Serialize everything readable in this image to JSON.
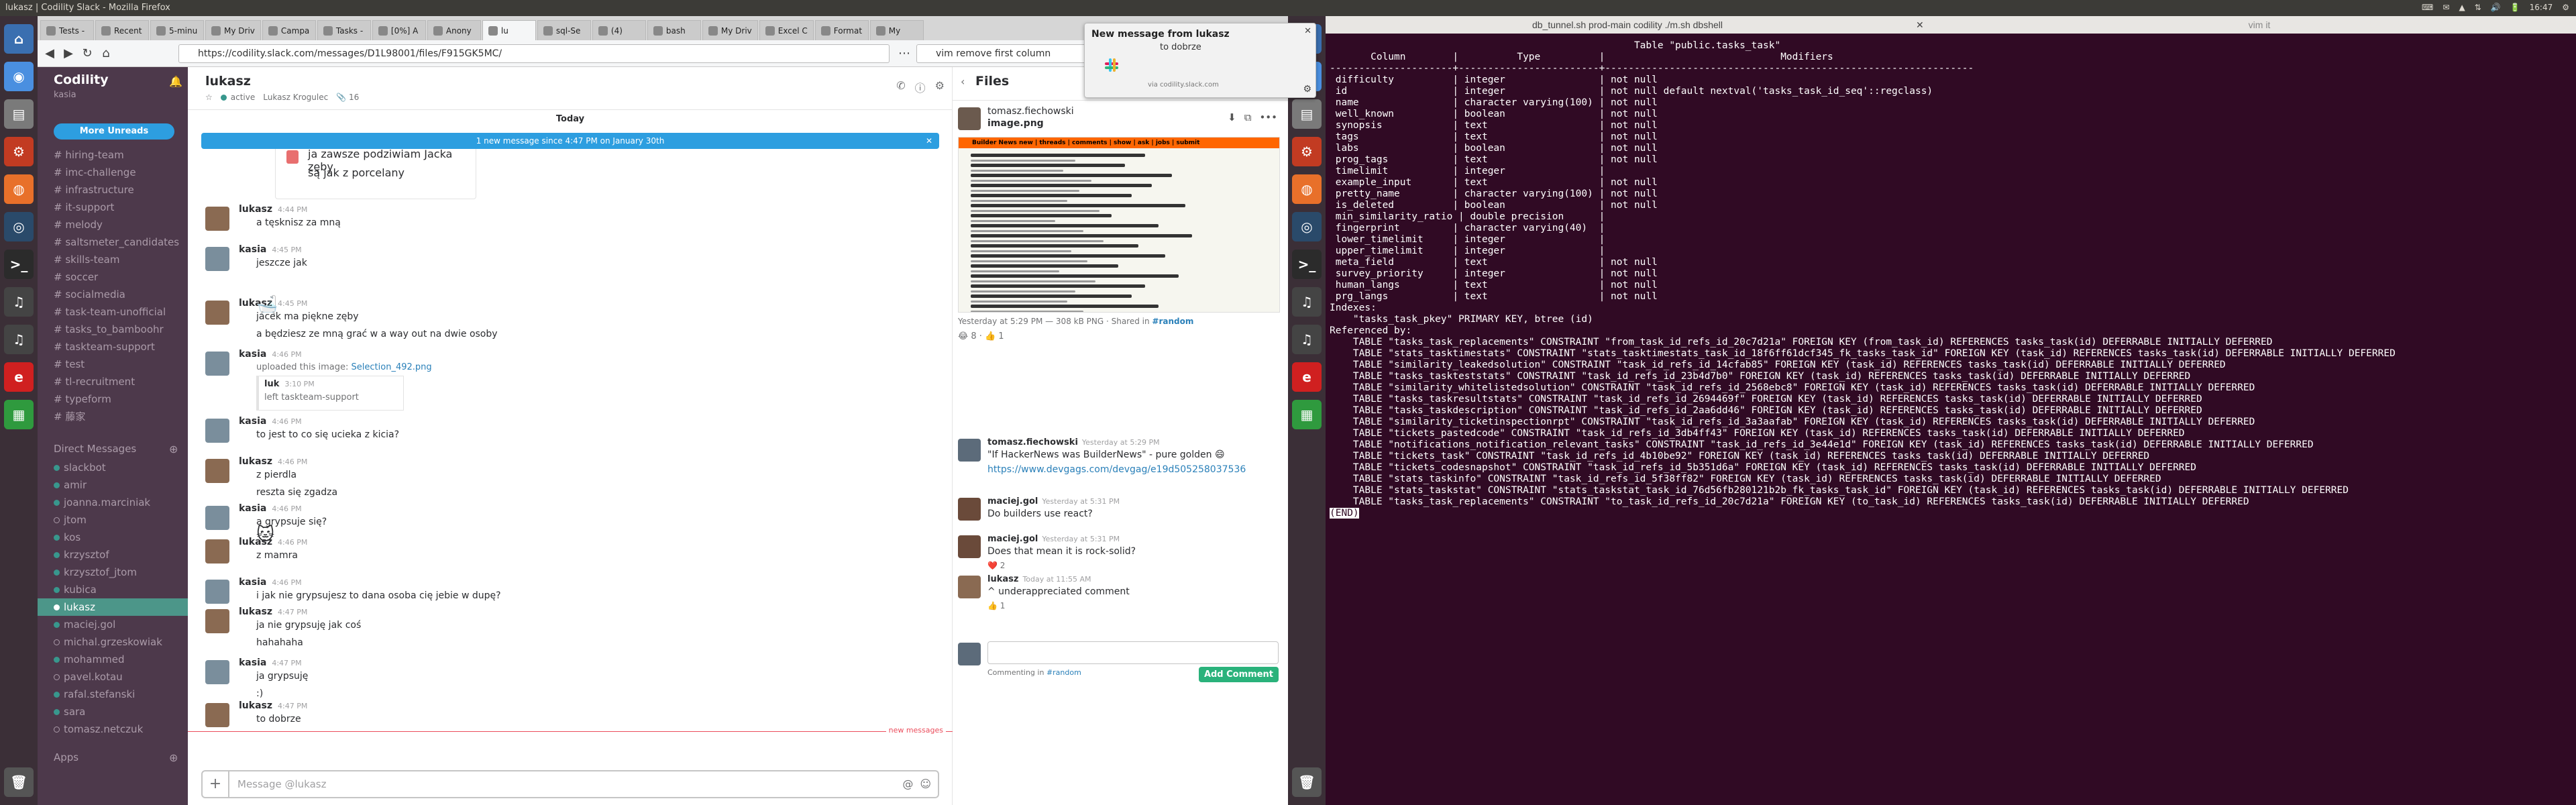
{
  "topbar": {
    "window_title": "lukasz | Codility Slack - Mozilla Firefox",
    "term_window_title": "",
    "tray": [
      "⌨",
      "✉",
      "▲",
      "⇅",
      "🔊",
      "🔋",
      "16:47",
      "⚙"
    ]
  },
  "launcher": {
    "left_icons": [
      "home-icon",
      "chrome-icon",
      "files-icon",
      "settings-icon",
      "firefox-icon",
      "steam-icon",
      "terminal-icon",
      "headphones-icon",
      "headphones-icon",
      "app-icon",
      "spreadsheet-icon"
    ],
    "trash": "trash-icon"
  },
  "firefox": {
    "tabs": [
      "Tests -",
      "Recent",
      "5-minu",
      "My Driv",
      "Campa",
      "Tasks -",
      "[0%] A",
      "Anony",
      "lu",
      "sql-Se",
      "(4)",
      "bash",
      "My Driv",
      "Excel C",
      "Format",
      "My"
    ],
    "active_tab_index": 8,
    "url": "https://codility.slack.com/messages/D1L98001/files/F915GK5MC/",
    "search_value": "vim remove first column"
  },
  "notification": {
    "title": "New message from lukasz",
    "body": "to dobrze",
    "via": "via codility.slack.com"
  },
  "sidebar": {
    "team": "Codility",
    "user": "kasia",
    "more_unreads": "More Unreads",
    "channels": [
      "hiring-team",
      "imc-challenge",
      "infrastructure",
      "it-support",
      "melody",
      "saltsmeter_candidates",
      "skills-team",
      "soccer",
      "socialmedia",
      "task-team-unofficial",
      "tasks_to_bamboohr",
      "taskteam-support",
      "test",
      "tl-recruitment",
      "typeform",
      "藤家"
    ],
    "dm_header": "Direct Messages",
    "dms": [
      {
        "name": "slackbot",
        "online": true,
        "bold": false
      },
      {
        "name": "amir",
        "online": true,
        "bold": false
      },
      {
        "name": "joanna.marciniak",
        "online": true,
        "bold": false
      },
      {
        "name": "jtom",
        "online": false,
        "bold": false
      },
      {
        "name": "kos",
        "online": true,
        "bold": false
      },
      {
        "name": "krzysztof",
        "online": true,
        "bold": false
      },
      {
        "name": "krzysztof_jtom",
        "online": true,
        "bold": false
      },
      {
        "name": "kubica",
        "online": true,
        "bold": false
      },
      {
        "name": "lukasz",
        "online": true,
        "bold": true,
        "selected": true
      },
      {
        "name": "maciej.gol",
        "online": true,
        "bold": false
      },
      {
        "name": "michal.grzeskowiak",
        "online": false,
        "bold": false
      },
      {
        "name": "mohammed",
        "online": true,
        "bold": false
      },
      {
        "name": "pavel.kotau",
        "online": false,
        "bold": false
      },
      {
        "name": "rafal.stefanski",
        "online": true,
        "bold": false
      },
      {
        "name": "sara",
        "online": true,
        "bold": false
      },
      {
        "name": "tomasz.netczuk",
        "online": false,
        "bold": false
      }
    ],
    "apps_header": "Apps"
  },
  "chat": {
    "name": "lukasz",
    "status": "active",
    "fullname": "Lukasz Krogulec",
    "files_count": "16",
    "today": "Today",
    "new_banner": "1 new message since 4:47 PM on January 30th",
    "quote_lines": [
      "ja zawsze podziwiam Jacka zęby",
      "są jak z porcelany"
    ],
    "new_messages_label": "new messages",
    "composer_placeholder": "Message @lukasz",
    "messages": [
      {
        "who": "lukasz",
        "time": "4:44 PM",
        "lines": [
          "a tęsknisz za mną"
        ]
      },
      {
        "who": "kasia",
        "time": "4:45 PM",
        "lines": [
          "jeszcze jak"
        ]
      },
      {
        "who": "lukasz",
        "time": "4:45 PM",
        "lines": [
          "jacek ma piękne zęby",
          "a będziesz ze mną grać w a way out na dwie osoby"
        ]
      },
      {
        "who": "kasia",
        "time": "4:46 PM",
        "upload": "uploaded this image:",
        "file": "Selection_492.png",
        "share_who": "luk",
        "share_time": "3:10 PM",
        "share_text": "left taskteam-support"
      },
      {
        "who": "kasia",
        "time": "4:46 PM",
        "lines": [
          "to jest to co się ucieka z kicia?"
        ]
      },
      {
        "who": "lukasz",
        "time": "4:46 PM",
        "lines": [
          "z pierdla",
          "reszta się zgadza"
        ]
      },
      {
        "who": "kasia",
        "time": "4:46 PM",
        "lines": [
          "a grypsuje się?"
        ]
      },
      {
        "who": "lukasz",
        "time": "4:46 PM",
        "lines": [
          "z mamra"
        ]
      },
      {
        "who": "kasia",
        "time": "4:46 PM",
        "lines": [
          "i jak nie grypsujesz to dana osoba cię jebie w dupę?"
        ]
      },
      {
        "who": "lukasz",
        "time": "4:47 PM",
        "lines": [
          "ja nie grypsuję jak coś",
          "hahahaha"
        ]
      },
      {
        "who": "kasia",
        "time": "4:47 PM",
        "lines": [
          "ja grypsuję",
          ":)"
        ]
      },
      {
        "who": "lukasz",
        "time": "4:47 PM",
        "lines": [
          "to dobrze"
        ]
      }
    ]
  },
  "files_panel": {
    "title": "Files",
    "uploader": "tomasz.fiechowski",
    "filename": "image.png",
    "meta": "Yesterday at 5:29 PM — 308 kB PNG · Shared in",
    "channel": "#random",
    "reactions": "😂 8 · 👍 1",
    "hn_header": "Builder News   new | threads | comments | show | ask | jobs | submit",
    "comments": [
      {
        "who": "tomasz.fiechowski",
        "time": "Yesterday at 5:29 PM",
        "text": "\"If HackerNews was BuilderNews\" - pure golden 😄",
        "link": "https://www.devgags.com/devgag/e19d505258037536"
      },
      {
        "who": "maciej.gol",
        "time": "Yesterday at 5:31 PM",
        "text": "Do builders use react?"
      },
      {
        "who": "maciej.gol",
        "time": "Yesterday at 5:31 PM",
        "text": "Does that mean it is rock-solid?",
        "react": "❤️ 2"
      },
      {
        "who": "lukasz",
        "time": "Today at 11:55 AM",
        "text": "^ underappreciated comment",
        "react": "👍 1"
      }
    ],
    "commenting_in": "Commenting in",
    "add_comment": "Add Comment"
  },
  "terminal": {
    "title": "db_tunnel.sh prod-main codility ./m.sh dbshell",
    "tab2": "vim it",
    "lines": [
      "                                                    Table \"public.tasks_task\"",
      "       Column        |          Type          |                              Modifiers",
      "---------------------+------------------------+---------------------------------------------------------------",
      " difficulty          | integer                | not null",
      " id                  | integer                | not null default nextval('tasks_task_id_seq'::regclass)",
      " name                | character varying(100) | not null",
      " well_known          | boolean                | not null",
      " synopsis            | text                   | not null",
      " tags                | text                   | not null",
      " labs                | boolean                | not null",
      " prog_tags           | text                   | not null",
      " timelimit           | integer                |",
      " example_input       | text                   | not null",
      " pretty_name         | character varying(100) | not null",
      " is_deleted          | boolean                | not null",
      " min_similarity_ratio | double precision      |",
      " fingerprint         | character varying(40)  |",
      " lower_timelimit     | integer                |",
      " upper_timelimit     | integer                |",
      " meta_field          | text                   | not null",
      " survey_priority     | integer                | not null",
      " human_langs         | text                   | not null",
      " prg_langs           | text                   | not null",
      "Indexes:",
      "    \"tasks_task_pkey\" PRIMARY KEY, btree (id)",
      "Referenced by:",
      "    TABLE \"tasks_task_replacements\" CONSTRAINT \"from_task_id_refs_id_20c7d21a\" FOREIGN KEY (from_task_id) REFERENCES tasks_task(id) DEFERRABLE INITIALLY DEFERRED",
      "    TABLE \"stats_tasktimestats\" CONSTRAINT \"stats_tasktimestats_task_id_18f6ff61dcf345_fk_tasks_task_id\" FOREIGN KEY (task_id) REFERENCES tasks_task(id) DEFERRABLE INITIALLY DEFERRED",
      "    TABLE \"similarity_leakedsolution\" CONSTRAINT \"task_id_refs_id_14cfab85\" FOREIGN KEY (task_id) REFERENCES tasks_task(id) DEFERRABLE INITIALLY DEFERRED",
      "    TABLE \"tasks_taskteststats\" CONSTRAINT \"task_id_refs_id_23b4d7b0\" FOREIGN KEY (task_id) REFERENCES tasks_task(id) DEFERRABLE INITIALLY DEFERRED",
      "    TABLE \"similarity_whitelistedsolution\" CONSTRAINT \"task_id_refs_id_2568ebc8\" FOREIGN KEY (task_id) REFERENCES tasks_task(id) DEFERRABLE INITIALLY DEFERRED",
      "    TABLE \"tasks_taskresultstats\" CONSTRAINT \"task_id_refs_id_2694469f\" FOREIGN KEY (task_id) REFERENCES tasks_task(id) DEFERRABLE INITIALLY DEFERRED",
      "    TABLE \"tasks_taskdescription\" CONSTRAINT \"task_id_refs_id_2aa6dd46\" FOREIGN KEY (task_id) REFERENCES tasks_task(id) DEFERRABLE INITIALLY DEFERRED",
      "    TABLE \"similarity_ticketinspectionrpt\" CONSTRAINT \"task_id_refs_id_3a3aafab\" FOREIGN KEY (task_id) REFERENCES tasks_task(id) DEFERRABLE INITIALLY DEFERRED",
      "    TABLE \"tickets_pastedcode\" CONSTRAINT \"task_id_refs_id_3db4ff43\" FOREIGN KEY (task_id) REFERENCES tasks_task(id) DEFERRABLE INITIALLY DEFERRED",
      "    TABLE \"notifications_notification_relevant_tasks\" CONSTRAINT \"task_id_refs_id_3e44e1d\" FOREIGN KEY (task_id) REFERENCES tasks_task(id) DEFERRABLE INITIALLY DEFERRED",
      "    TABLE \"tickets_task\" CONSTRAINT \"task_id_refs_id_4b10be92\" FOREIGN KEY (task_id) REFERENCES tasks_task(id) DEFERRABLE INITIALLY DEFERRED",
      "    TABLE \"tickets_codesnapshot\" CONSTRAINT \"task_id_refs_id_5b351d6a\" FOREIGN KEY (task_id) REFERENCES tasks_task(id) DEFERRABLE INITIALLY DEFERRED",
      "    TABLE \"stats_taskinfo\" CONSTRAINT \"task_id_refs_id_5f38ff82\" FOREIGN KEY (task_id) REFERENCES tasks_task(id) DEFERRABLE INITIALLY DEFERRED",
      "    TABLE \"stats_taskstat\" CONSTRAINT \"stats_taskstat_task_id_76d56fb280121b2b_fk_tasks_task_id\" FOREIGN KEY (task_id) REFERENCES tasks_task(id) DEFERRABLE INITIALLY DEFERRED",
      "    TABLE \"tasks_task_replacements\" CONSTRAINT \"to_task_id_refs_id_20c7d21a\" FOREIGN KEY (to_task_id) REFERENCES tasks_task(id) DEFERRABLE INITIALLY DEFERRED"
    ],
    "prompt": "(END)"
  },
  "colors": {
    "sidebar": "#4d394b",
    "selected": "#4c9689",
    "accent": "#2d9ee0",
    "terminal_bg": "#300a24"
  }
}
